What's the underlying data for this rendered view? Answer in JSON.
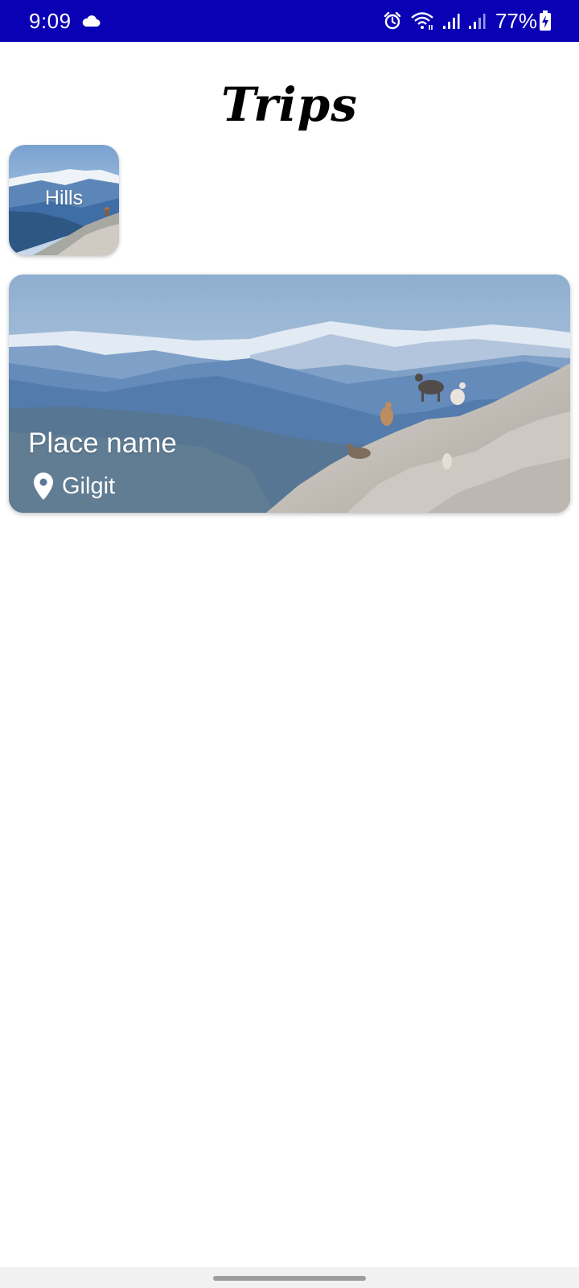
{
  "status_bar": {
    "time": "9:09",
    "battery": "77%",
    "icons": [
      "cloud-icon",
      "alarm-icon",
      "wifi-icon",
      "signal-icon",
      "signal-icon-2",
      "battery-charging-icon"
    ],
    "background": "#0a00b4"
  },
  "header": {
    "title": "Trips"
  },
  "categories": [
    {
      "label": "Hills"
    }
  ],
  "places": [
    {
      "name": "Place name",
      "location": "Gilgit",
      "icon": "location-pin-icon"
    }
  ]
}
